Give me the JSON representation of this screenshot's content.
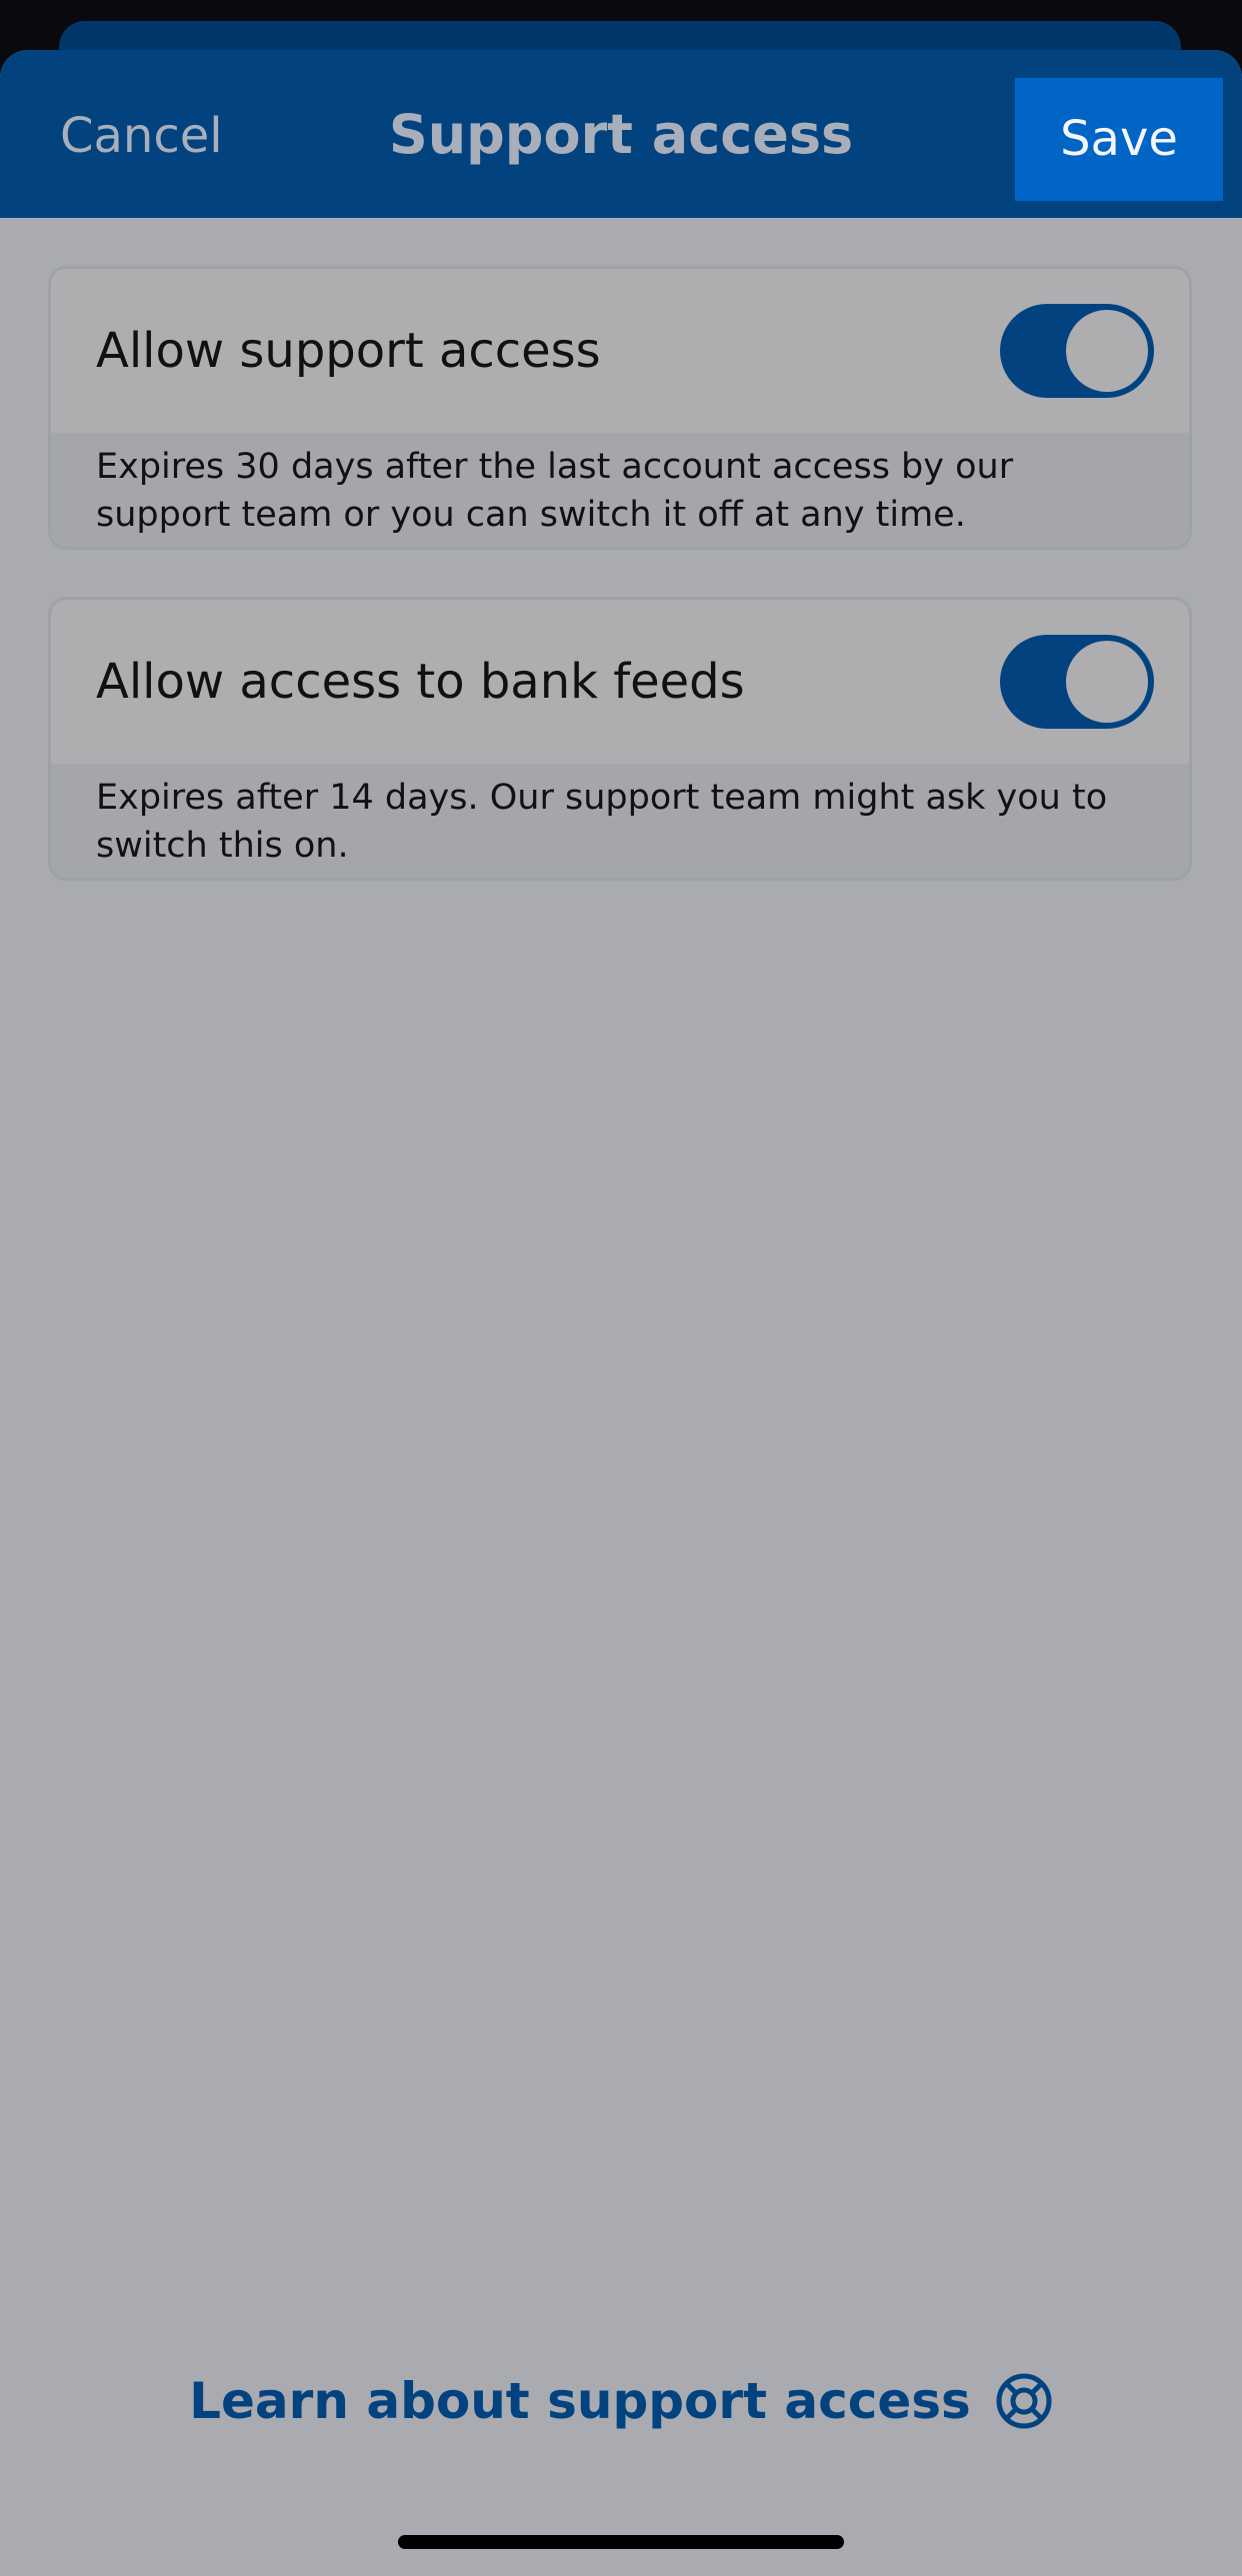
{
  "header": {
    "cancel_label": "Cancel",
    "title": "Support access",
    "save_label": "Save"
  },
  "settings": [
    {
      "label": "Allow support access",
      "description": "Expires 30 days after the last account access by our support team or you can switch it off at any time.",
      "enabled": true
    },
    {
      "label": "Allow access to bank feeds",
      "description": "Expires after 14 days. Our support team might ask you to switch this on.",
      "enabled": true
    }
  ],
  "footer": {
    "learn_link_label": "Learn about support access",
    "learn_link_icon": "lifebuoy-icon"
  },
  "colors": {
    "brand_blue": "#02437f",
    "save_blue": "#0065c4",
    "overlay_gray": "#a9abb1"
  }
}
